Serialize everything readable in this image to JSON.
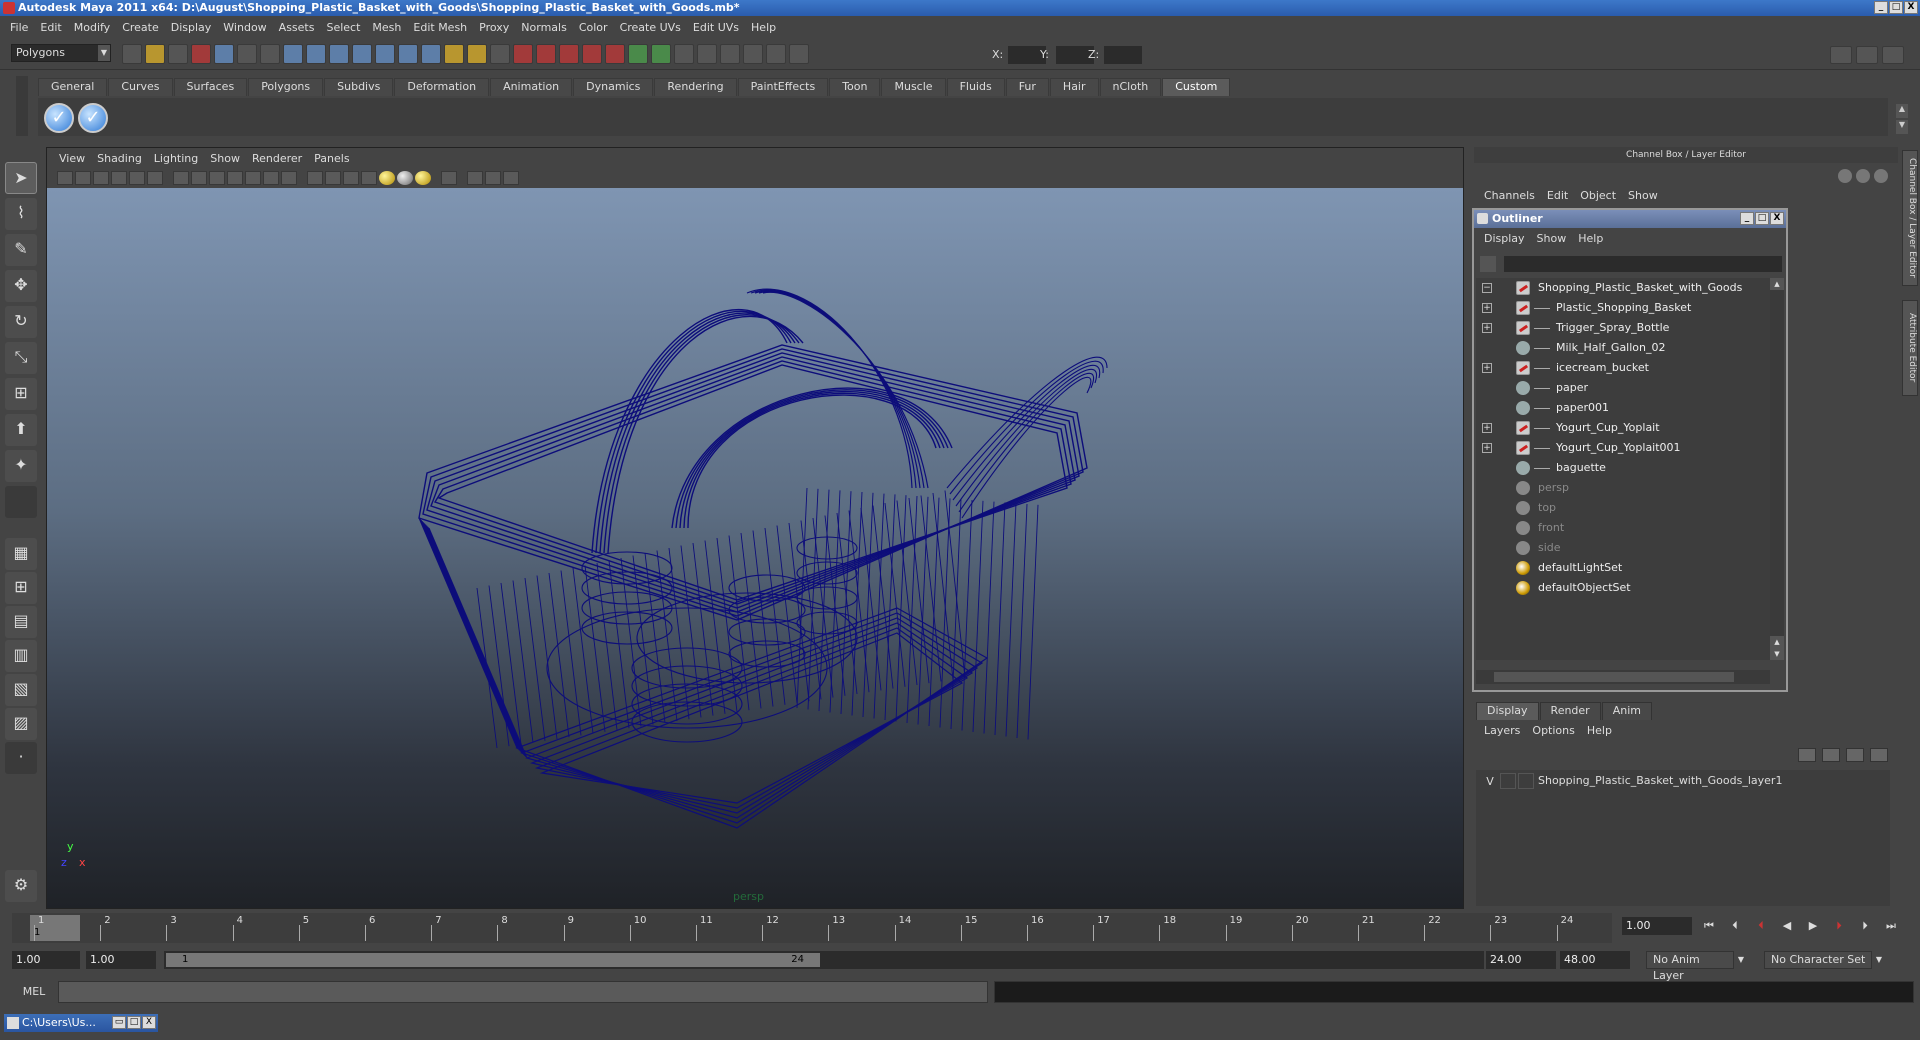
{
  "window": {
    "title": "Autodesk Maya 2011 x64: D:\\August\\Shopping_Plastic_Basket_with_Goods\\Shopping_Plastic_Basket_with_Goods.mb*",
    "buttons": [
      "_",
      "□",
      "X"
    ]
  },
  "menubar": [
    "File",
    "Edit",
    "Modify",
    "Create",
    "Display",
    "Window",
    "Assets",
    "Select",
    "Mesh",
    "Edit Mesh",
    "Proxy",
    "Normals",
    "Color",
    "Create UVs",
    "Edit UVs",
    "Help"
  ],
  "statusline": {
    "mode": "Polygons",
    "x_label": "X:",
    "y_label": "Y:",
    "z_label": "Z:"
  },
  "shelf": {
    "tabs": [
      "General",
      "Curves",
      "Surfaces",
      "Polygons",
      "Subdivs",
      "Deformation",
      "Animation",
      "Dynamics",
      "Rendering",
      "PaintEffects",
      "Toon",
      "Muscle",
      "Fluids",
      "Fur",
      "Hair",
      "nCloth",
      "Custom"
    ],
    "active_tab": "Custom",
    "buttons": [
      "checkmark-icon",
      "checkmark-icon"
    ]
  },
  "viewport": {
    "menus": [
      "View",
      "Shading",
      "Lighting",
      "Show",
      "Renderer",
      "Panels"
    ],
    "camera_label": "persp",
    "axis": {
      "x": "x",
      "y": "y",
      "z": "z"
    },
    "wire_color": "#0d0d7a"
  },
  "channel_box": {
    "title": "Channel Box / Layer Editor",
    "menus": [
      "Channels",
      "Edit",
      "Object",
      "Show"
    ]
  },
  "outliner": {
    "title": "Outliner",
    "menus": [
      "Display",
      "Show",
      "Help"
    ],
    "items": [
      {
        "label": "Shopping_Plastic_Basket_with_Goods",
        "type": "mesh",
        "expander": "−",
        "depth": 0,
        "dim": false
      },
      {
        "label": "Plastic_Shopping_Basket",
        "type": "mesh",
        "expander": "+",
        "depth": 1,
        "dim": false
      },
      {
        "label": "Trigger_Spray_Bottle",
        "type": "mesh",
        "expander": "+",
        "depth": 1,
        "dim": false
      },
      {
        "label": "Milk_Half_Gallon_02",
        "type": "grp",
        "expander": "",
        "depth": 1,
        "dim": false
      },
      {
        "label": "icecream_bucket",
        "type": "mesh",
        "expander": "+",
        "depth": 1,
        "dim": false
      },
      {
        "label": "paper",
        "type": "grp",
        "expander": "",
        "depth": 1,
        "dim": false
      },
      {
        "label": "paper001",
        "type": "grp",
        "expander": "",
        "depth": 1,
        "dim": false
      },
      {
        "label": "Yogurt_Cup_Yoplait",
        "type": "mesh",
        "expander": "+",
        "depth": 1,
        "dim": false
      },
      {
        "label": "Yogurt_Cup_Yoplait001",
        "type": "mesh",
        "expander": "+",
        "depth": 1,
        "dim": false
      },
      {
        "label": "baguette",
        "type": "grp",
        "expander": "",
        "depth": 1,
        "dim": false
      },
      {
        "label": "persp",
        "type": "cam",
        "expander": "",
        "depth": 0,
        "dim": true
      },
      {
        "label": "top",
        "type": "cam",
        "expander": "",
        "depth": 0,
        "dim": true
      },
      {
        "label": "front",
        "type": "cam",
        "expander": "",
        "depth": 0,
        "dim": true
      },
      {
        "label": "side",
        "type": "cam",
        "expander": "",
        "depth": 0,
        "dim": true
      },
      {
        "label": "defaultLightSet",
        "type": "set",
        "expander": "",
        "depth": 0,
        "dim": false
      },
      {
        "label": "defaultObjectSet",
        "type": "set",
        "expander": "",
        "depth": 0,
        "dim": false
      }
    ]
  },
  "layer_editor": {
    "tabs": [
      "Display",
      "Render",
      "Anim"
    ],
    "active_tab": "Display",
    "menus": [
      "Layers",
      "Options",
      "Help"
    ],
    "layers": [
      {
        "visible": "V",
        "name": "Shopping_Plastic_Basket_with_Goods_layer1"
      }
    ]
  },
  "side_tabs": [
    "Channel Box / Layer Editor",
    "Attribute Editor"
  ],
  "timeslider": {
    "ticks": [
      "1",
      "2",
      "3",
      "4",
      "5",
      "6",
      "7",
      "8",
      "9",
      "10",
      "11",
      "12",
      "13",
      "14",
      "15",
      "16",
      "17",
      "18",
      "19",
      "20",
      "21",
      "22",
      "23",
      "24"
    ],
    "current_frame": "1",
    "current_frame_field": "1.00"
  },
  "rangeslider": {
    "start_time": "1.00",
    "playback_start": "1.00",
    "handle_start": "1",
    "handle_end": "24",
    "playback_end": "24.00",
    "end_time": "48.00",
    "anim_layer": "No Anim Layer",
    "character_set": "No Character Set"
  },
  "command_line": {
    "label": "MEL"
  },
  "taskbar": {
    "minimized_window": "C:\\Users\\Us..."
  }
}
